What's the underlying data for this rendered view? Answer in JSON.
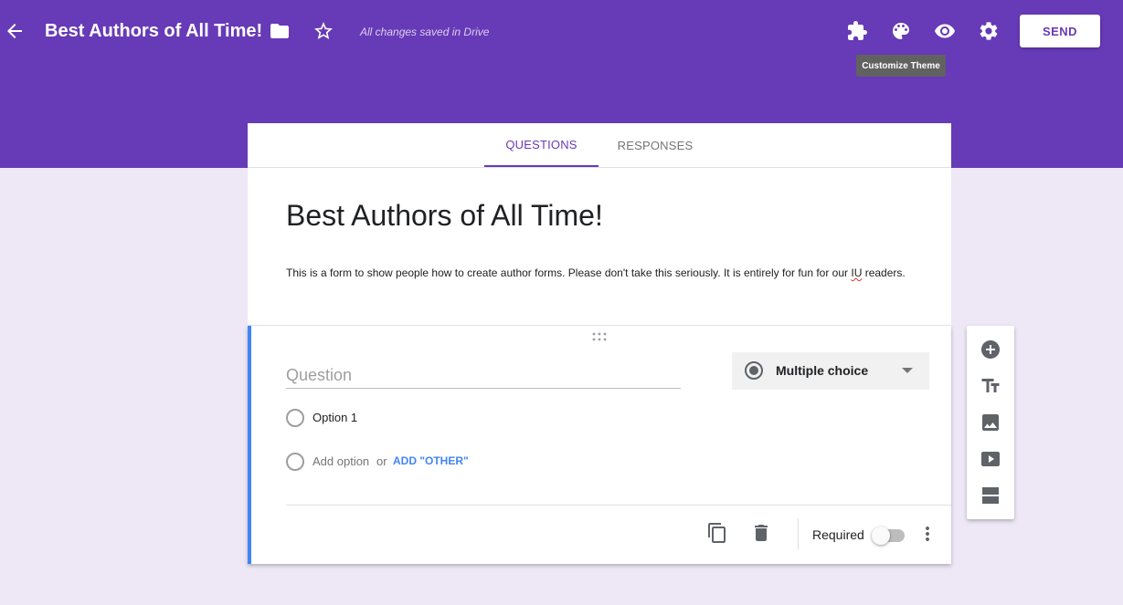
{
  "header": {
    "form_name": "Best Authors of All Time!",
    "save_status": "All changes saved in Drive",
    "send_label": "SEND",
    "tooltip": "Customize Theme"
  },
  "tabs": [
    {
      "label": "QUESTIONS",
      "active": true
    },
    {
      "label": "RESPONSES",
      "active": false
    }
  ],
  "form": {
    "title": "Best Authors of All Time!",
    "description_before": "This is a form to show people how to create author forms. Please don't take this seriously. It is entirely for fun for our ",
    "description_flagged": "IU",
    "description_after": " readers."
  },
  "question": {
    "placeholder": "Question",
    "type": "Multiple choice",
    "option1": "Option 1",
    "add_option": "Add option",
    "or": "or",
    "add_other": "ADD \"OTHER\"",
    "required_label": "Required",
    "required": false
  },
  "colors": {
    "brand": "#673ab7",
    "background": "#ede7f6",
    "active_question_accent": "#4285f4"
  },
  "icons": {
    "toolbar": [
      "add-ons-icon",
      "palette-icon",
      "preview-eye-icon",
      "settings-gear-icon"
    ],
    "side_tools": [
      "add-question-icon",
      "add-title-icon",
      "add-image-icon",
      "add-video-icon",
      "add-section-icon"
    ]
  }
}
